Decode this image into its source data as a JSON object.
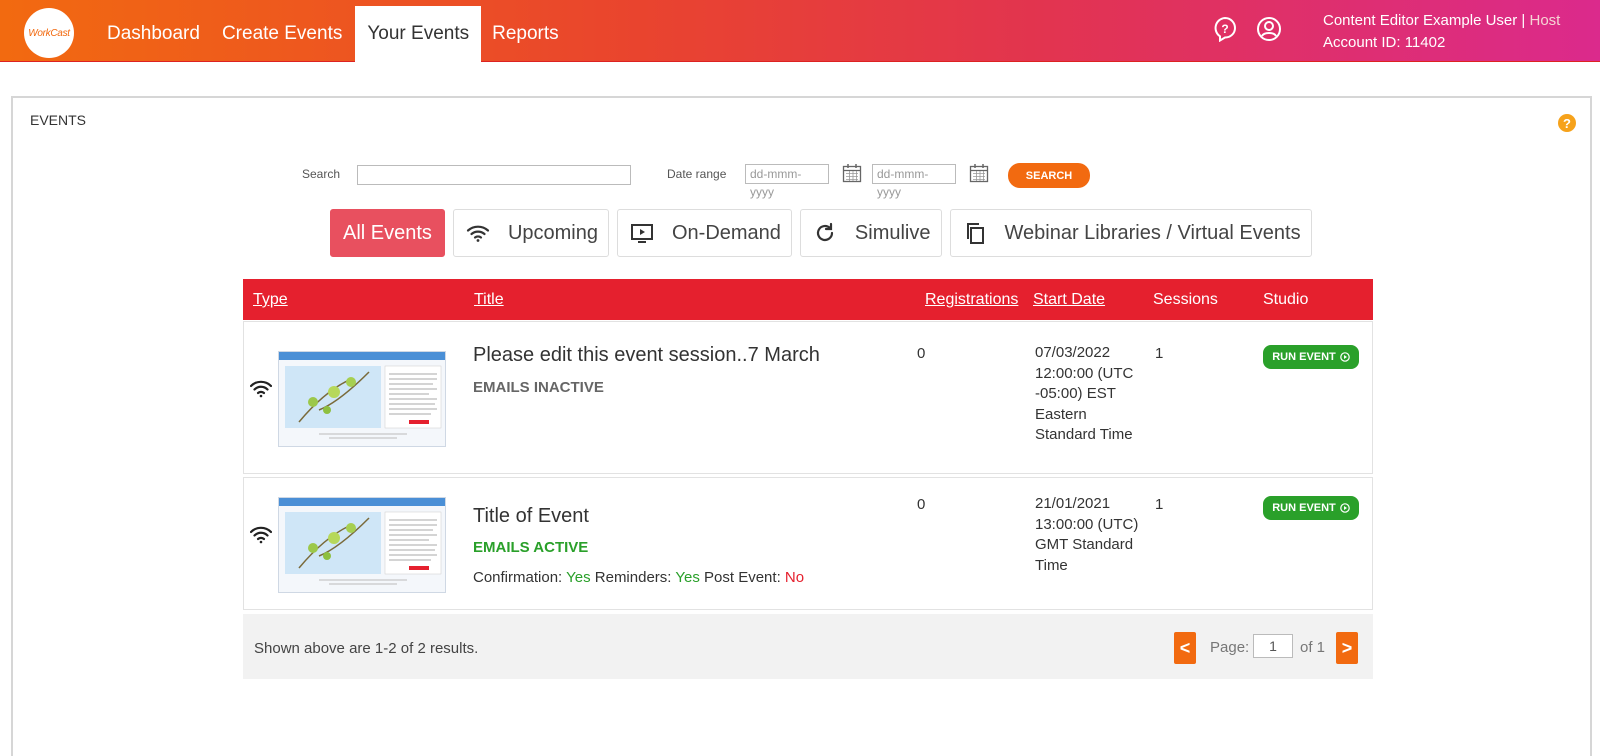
{
  "header": {
    "logo_text": "WorkCast",
    "nav": [
      {
        "label": "Dashboard"
      },
      {
        "label": "Create Events"
      },
      {
        "label": "Your Events"
      },
      {
        "label": "Reports"
      }
    ],
    "user_name": "Content Editor Example User |",
    "user_role": "Host",
    "account": "Account ID: 11402"
  },
  "panel": {
    "title": "EVENTS",
    "search_label": "Search",
    "search_value": "",
    "date_range_label": "Date range",
    "date_from_placeholder": "dd-mmm-yyyy",
    "date_to_placeholder": "dd-mmm-yyyy",
    "search_button": "SEARCH"
  },
  "filters": [
    {
      "label": "All Events",
      "icon": "none",
      "active": true
    },
    {
      "label": "Upcoming",
      "icon": "wifi-icon"
    },
    {
      "label": "On-Demand",
      "icon": "play-screen-icon"
    },
    {
      "label": "Simulive",
      "icon": "refresh-icon"
    },
    {
      "label": "Webinar Libraries / Virtual Events",
      "icon": "copy-icon"
    }
  ],
  "table": {
    "headers": {
      "type": "Type",
      "title": "Title",
      "registrations": "Registrations",
      "start_date": "Start Date",
      "sessions": "Sessions",
      "studio": "Studio"
    },
    "rows": [
      {
        "title": "Please edit this event session..7 March",
        "emails_status": "EMAILS INACTIVE",
        "registrations": "0",
        "start_date": "07/03/2022 12:00:00 (UTC -05:00) EST Eastern Standard Time",
        "sessions": "1",
        "run_label": "RUN EVENT"
      },
      {
        "title": "Title of Event",
        "emails_status": "EMAILS ACTIVE",
        "confirmation_label": "Confirmation:",
        "confirmation_value": "Yes",
        "reminders_label": "Reminders:",
        "reminders_value": "Yes",
        "post_event_label": "Post Event:",
        "post_event_value": "No",
        "registrations": "0",
        "start_date": "21/01/2021 13:00:00 (UTC) GMT Standard Time",
        "sessions": "1",
        "run_label": "RUN EVENT"
      }
    ]
  },
  "footer": {
    "results_text": "Shown above are 1-2 of 2 results.",
    "prev_label": "<",
    "next_label": ">",
    "page_label": "Page:",
    "page_value": "1",
    "page_total": "of 1"
  }
}
